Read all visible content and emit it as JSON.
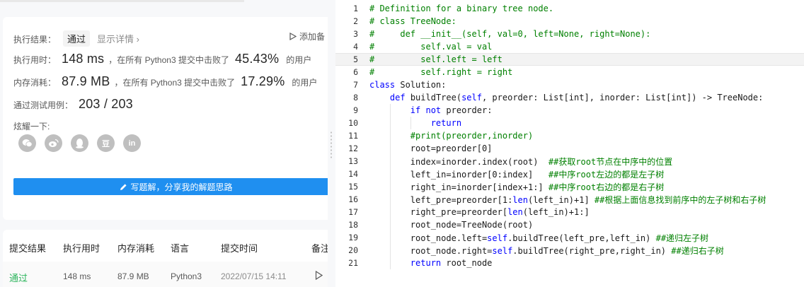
{
  "result": {
    "status_label": "执行结果：",
    "status_value": "通过",
    "detail_link": "显示详情 ›",
    "add_note": "添加备",
    "runtime_label": "执行用时：",
    "runtime_value": "148 ms",
    "runtime_text": "，在所有 Python3 提交中击败了",
    "runtime_percent": "45.43%",
    "runtime_suffix": "的用户",
    "memory_label": "内存消耗：",
    "memory_value": "87.9 MB",
    "memory_text": "，在所有 Python3 提交中击败了",
    "memory_percent": "17.29%",
    "memory_suffix": "的用户",
    "tests_label": "通过测试用例：",
    "tests_value": "203 / 203",
    "share_label": "炫耀一下:",
    "share_icons": [
      "wechat-icon",
      "weibo-icon",
      "qq-icon",
      "douban-icon",
      "linkedin-icon"
    ],
    "share_douban": "豆",
    "share_linkedin": "in",
    "write_button": "写题解，分享我的解题思路"
  },
  "submissions": {
    "headers": [
      "提交结果",
      "执行用时",
      "内存消耗",
      "语言",
      "提交时间",
      "备注"
    ],
    "row": {
      "status": "通过",
      "runtime": "148 ms",
      "memory": "87.9 MB",
      "language": "Python3",
      "time": "2022/07/15 14:11"
    }
  },
  "colors": {
    "accent": "#1f8ff0",
    "success": "#2db55d",
    "comment": "#008000",
    "keyword": "#0000ff"
  },
  "editor": {
    "active_line": 5,
    "lines": [
      "# Definition for a binary tree node.",
      "# class TreeNode:",
      "#     def __init__(self, val=0, left=None, right=None):",
      "#         self.val = val",
      "#         self.left = left",
      "#         self.right = right",
      "class Solution:",
      "    def buildTree(self, preorder: List[int], inorder: List[int]) -> TreeNode:",
      "        if not preorder:",
      "            return",
      "        #print(preorder,inorder)",
      "        root=preorder[0]",
      "        index=inorder.index(root)  ##获取root节点在中序中的位置",
      "        left_in=inorder[0:index]   ##中序root左边的都是左子树",
      "        right_in=inorder[index+1:] ##中序root右边的都是右子树",
      "        left_pre=preorder[1:len(left_in)+1] ##根据上面信息找到前序中的左子树和右子树",
      "        right_pre=preorder[len(left_in)+1:]",
      "        root_node=TreeNode(root)",
      "        root_node.left=self.buildTree(left_pre,left_in) ##递归左子树",
      "        root_node.right=self.buildTree(right_pre,right_in) ##递归右子树",
      "        return root_node"
    ]
  }
}
